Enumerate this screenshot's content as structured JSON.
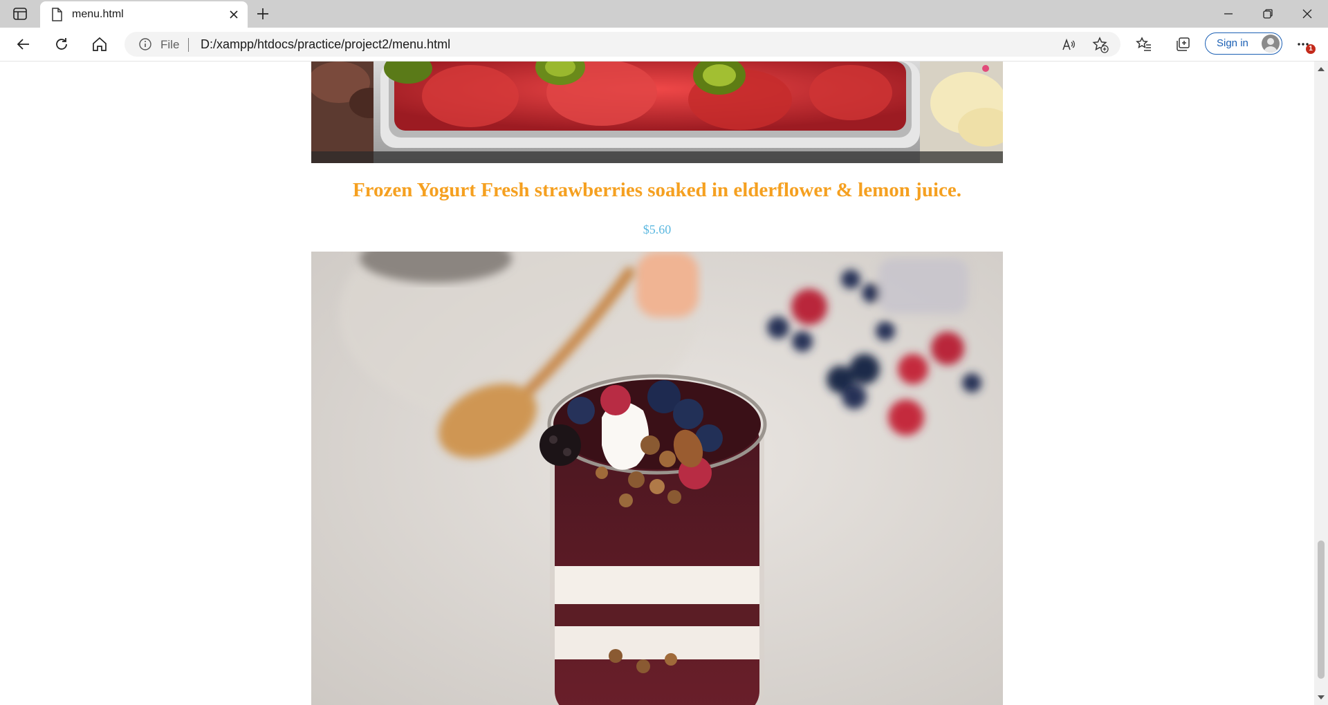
{
  "browser": {
    "tab": {
      "title": "menu.html"
    },
    "address": {
      "scheme_label": "File",
      "url": "D:/xampp/htdocs/practice/project2/menu.html"
    },
    "sign_in_label": "Sign in",
    "notification_count": "1",
    "accent": "#1a5fb4"
  },
  "icons": [
    "sidebar-toggle-icon",
    "file-icon",
    "close-icon",
    "plus-icon",
    "minimize-icon",
    "restore-icon",
    "window-close-icon",
    "back-arrow-icon",
    "refresh-icon",
    "home-icon",
    "info-icon",
    "read-aloud-icon",
    "add-favorite-icon",
    "favorites-icon",
    "collections-icon",
    "avatar-icon",
    "more-icon"
  ],
  "menu": {
    "item": {
      "title": "Frozen Yogurt Fresh strawberries soaked in elderflower & lemon juice.",
      "price": "$5.60",
      "title_color": "#f5a020",
      "price_color": "#5bb8e0"
    }
  }
}
